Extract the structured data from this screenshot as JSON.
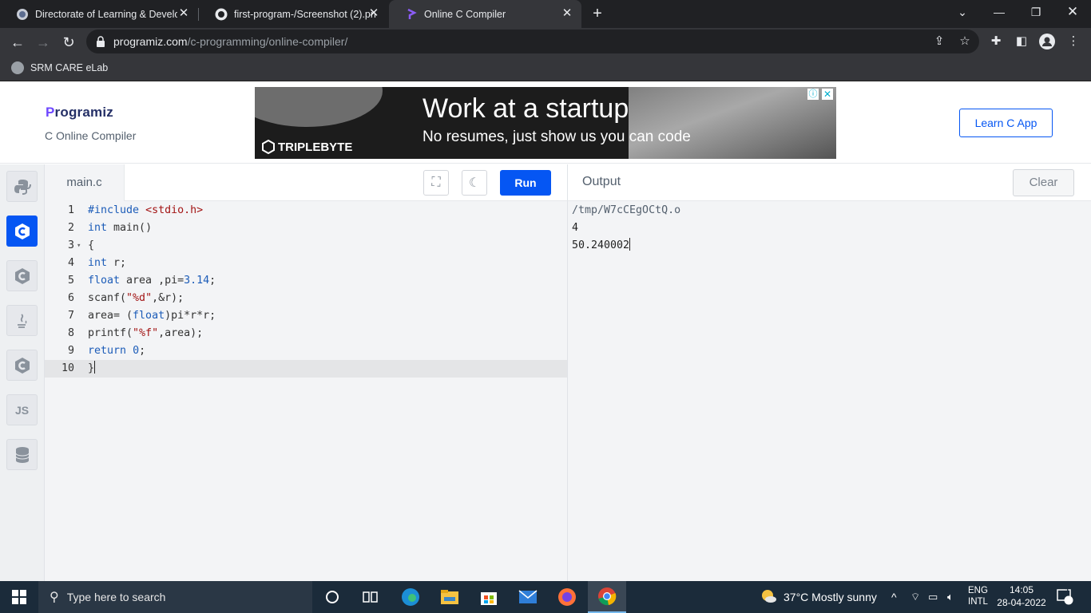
{
  "browser": {
    "tabs": [
      {
        "title": "Directorate of Learning & Develo",
        "active": false
      },
      {
        "title": "first-program-/Screenshot (2).pn",
        "active": false
      },
      {
        "title": "Online C Compiler",
        "active": true
      }
    ],
    "url_domain": "programiz.com",
    "url_path": "/c-programming/online-compiler/",
    "bookmark": "SRM CARE eLab"
  },
  "header": {
    "logo_text": "rogramiz",
    "logo_initial": "P",
    "subtitle": "C Online Compiler",
    "learn_button": "Learn C App"
  },
  "ad": {
    "headline": "Work at a startup",
    "subline": "No resumes, just show us you can code",
    "brand": "TRIPLEBYTE"
  },
  "rail": {
    "languages": [
      "python",
      "c",
      "cpp",
      "java",
      "csharp",
      "JS",
      "sql"
    ],
    "js_label": "JS"
  },
  "editor": {
    "filename": "main.c",
    "run_label": "Run",
    "lines": [
      {
        "n": "1"
      },
      {
        "n": "2"
      },
      {
        "n": "3"
      },
      {
        "n": "4"
      },
      {
        "n": "5"
      },
      {
        "n": "6"
      },
      {
        "n": "7"
      },
      {
        "n": "8"
      },
      {
        "n": "9"
      },
      {
        "n": "10"
      }
    ]
  },
  "output": {
    "title": "Output",
    "clear_label": "Clear",
    "lines": [
      "/tmp/W7cCEgOCtQ.o",
      "4",
      "50.240002"
    ]
  },
  "taskbar": {
    "search_placeholder": "Type here to search",
    "weather": "37°C  Mostly sunny",
    "lang_top": "ENG",
    "lang_bottom": "INTL",
    "time": "14:05",
    "date": "28-04-2022",
    "notif_count": "1"
  }
}
